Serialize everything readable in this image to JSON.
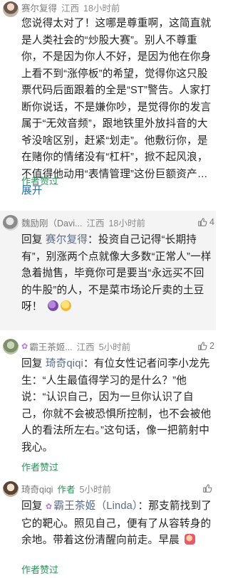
{
  "comments": [
    {
      "name": "赛尔复得",
      "location": "江西",
      "time": "18小时前",
      "likes": "",
      "text": "您说得太对了！这哪是尊重啊，这简直就是人类社会的“炒股大赛”。别人不尊重你，不是因为你人不好，是因为他在你身上看不到“涨停板”的希望，觉得你这只股票代码后面跟着的全是“ST”警告。人家打断你说话，不是嫌你吵，是觉得你的发言属于“无效音频”，跟地铁里外放抖音的大爷没啥区别，赶紧“划走”。他敷衍你，是在赌你的情绪没有“杠杆”，掀不起风浪，不值得他动用“表情管理”这份巨额资产…",
      "expand": "展开",
      "author_liked": "作者赞过"
    },
    {
      "name": "魏励刚（Davi...",
      "location": "江西",
      "time": "18小时前",
      "likes": "4",
      "reply_prefix": "回复",
      "reply_to": "赛尔复得",
      "text": "：投资自己记得“长期持有”，别涨两个点就像大多数“正常人”一样急着抛售，毕竟你可是要当“永远买不回的牛股”的人，不是菜市场论斤卖的土豆呀！",
      "author_liked": "作者赞过"
    },
    {
      "name": "霸王茶姬...",
      "location": "江西",
      "time": "5小时前",
      "likes": "2",
      "reply_prefix": "回复",
      "reply_to": "琦奇qiqi",
      "text": "：有位女性记者问李小龙先生：“人生最值得学习的是什么？”他说：“认识自己，因为一旦你认识了自己，你就不会被恐惧所控制，也不会被他人的看法所左右。”这句话，像一把箭射中我心。",
      "author_liked": "作者赞过"
    },
    {
      "name": "琦奇qiqi",
      "badge": "作者",
      "time": "5小时前",
      "likes": "",
      "reply_prefix": "回复",
      "reply_to": "霸王茶姬",
      "reply_to_suffix": "（Linda）",
      "text": "：那支箭找到了它的靶心。照见自己，便有了从容转身的余地。带着这份清醒向前走。早晨",
      "author_liked": "作者赞过"
    }
  ],
  "colors": {
    "accent_green": "#2f8f5b",
    "link_blue": "#2e6ea6",
    "alt_bg": "#f4f4f4"
  },
  "icons": [
    "thumb-up-icon",
    "avatar",
    "flower-icon",
    "emoji-icon"
  ]
}
